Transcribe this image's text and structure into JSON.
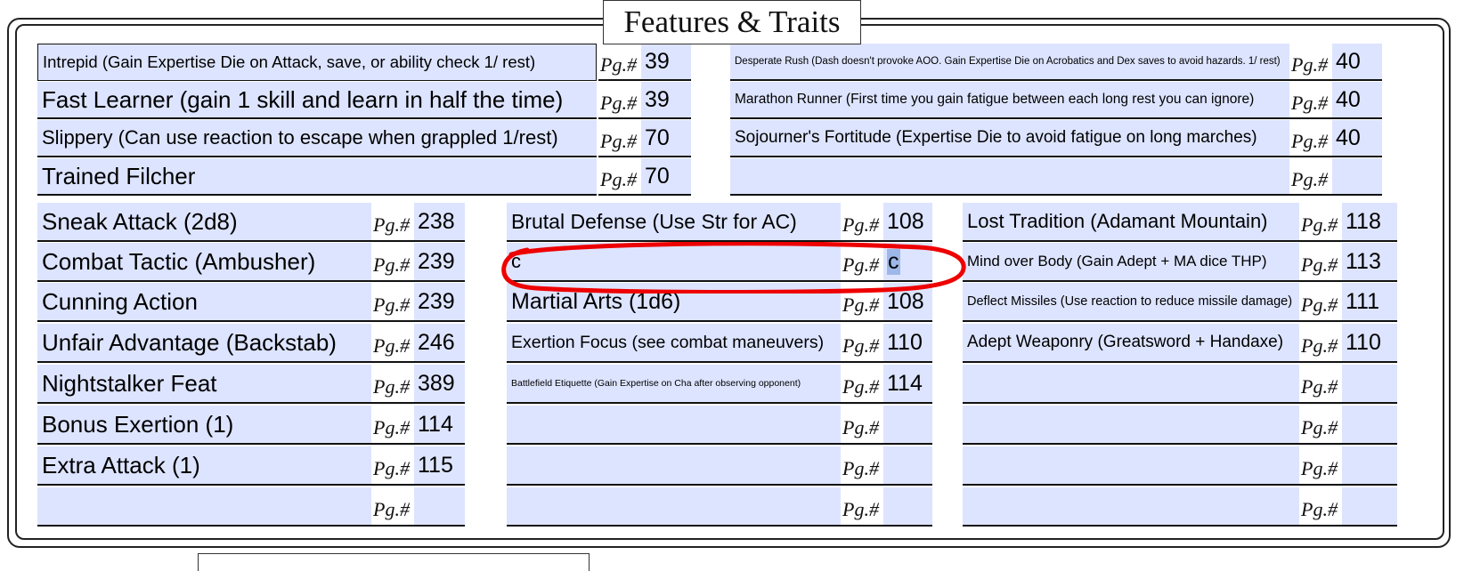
{
  "page_title": "Features & Traits",
  "pg_label": "Pg.#",
  "traits_left": [
    {
      "text": "Intrepid (Gain Expertise Die on Attack, save, or ability check 1/ rest)",
      "pg": "39"
    },
    {
      "text": "Fast Learner (gain 1 skill and learn in half the time)",
      "pg": "39"
    },
    {
      "text": "Slippery (Can use reaction to escape when grappled 1/rest)",
      "pg": "70"
    },
    {
      "text": "Trained Filcher",
      "pg": "70"
    }
  ],
  "traits_right": [
    {
      "text": "Desperate Rush (Dash doesn't provoke AOO. Gain Expertise Die on Acrobatics and Dex saves to avoid hazards. 1/ rest)",
      "pg": "40"
    },
    {
      "text": "Marathon Runner (First time you gain fatigue between each long rest you can ignore)",
      "pg": "40"
    },
    {
      "text": "Sojourner's Fortitude (Expertise Die to avoid fatigue on long marches)",
      "pg": "40"
    },
    {
      "text": "",
      "pg": ""
    }
  ],
  "features_col1": [
    {
      "text": "Sneak Attack (2d8)",
      "pg": "238"
    },
    {
      "text": "Combat Tactic (Ambusher)",
      "pg": "239"
    },
    {
      "text": "Cunning Action",
      "pg": "239"
    },
    {
      "text": "Unfair Advantage (Backstab)",
      "pg": "246"
    },
    {
      "text": "Nightstalker Feat",
      "pg": "389"
    },
    {
      "text": "Bonus Exertion (1)",
      "pg": "114"
    },
    {
      "text": "Extra Attack (1)",
      "pg": "115"
    },
    {
      "text": "",
      "pg": ""
    }
  ],
  "features_col2": [
    {
      "text": "Brutal Defense (Use Str for AC)",
      "pg": "108"
    },
    {
      "text": "c",
      "pg": "c"
    },
    {
      "text": "Martial Arts (1d6)",
      "pg": "108"
    },
    {
      "text": "Exertion Focus (see combat maneuvers)",
      "pg": "110"
    },
    {
      "text": "Battlefield Etiquette (Gain Expertise on Cha after observing opponent)",
      "pg": "114"
    },
    {
      "text": "",
      "pg": ""
    },
    {
      "text": "",
      "pg": ""
    },
    {
      "text": "",
      "pg": ""
    }
  ],
  "features_col3": [
    {
      "text": "Lost Tradition (Adamant Mountain)",
      "pg": "118"
    },
    {
      "text": "Mind over Body (Gain Adept + MA dice THP)",
      "pg": "113"
    },
    {
      "text": "Deflect Missiles (Use reaction to reduce missile damage)",
      "pg": "111"
    },
    {
      "text": "Adept Weaponry (Greatsword + Handaxe)",
      "pg": "110"
    },
    {
      "text": "",
      "pg": ""
    },
    {
      "text": "",
      "pg": ""
    },
    {
      "text": "",
      "pg": ""
    },
    {
      "text": "",
      "pg": ""
    }
  ],
  "colors": {
    "field_fill": "#dde4ff",
    "annotation": "#ee0000",
    "selection": "#9db8e8"
  }
}
